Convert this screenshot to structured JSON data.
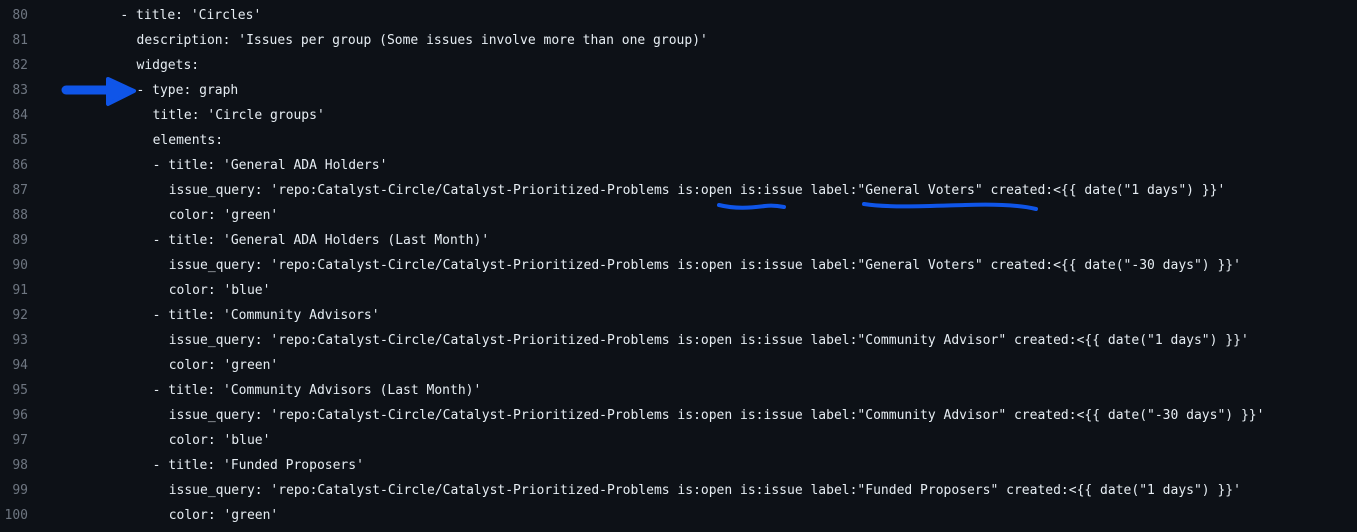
{
  "editor": {
    "accent_color": "#0f55e8",
    "lines": [
      {
        "number": "80",
        "indent": 8,
        "text": "- title: 'Circles'"
      },
      {
        "number": "81",
        "indent": 10,
        "text": "description: 'Issues per group (Some issues involve more than one group)'"
      },
      {
        "number": "82",
        "indent": 10,
        "text": "widgets:"
      },
      {
        "number": "83",
        "indent": 10,
        "text": "- type: graph"
      },
      {
        "number": "84",
        "indent": 12,
        "text": "title: 'Circle groups'"
      },
      {
        "number": "85",
        "indent": 12,
        "text": "elements:"
      },
      {
        "number": "86",
        "indent": 12,
        "text": "- title: 'General ADA Holders'"
      },
      {
        "number": "87",
        "indent": 14,
        "text": "issue_query: 'repo:Catalyst-Circle/Catalyst-Prioritized-Problems is:open is:issue label:\"General Voters\" created:<{{ date(\"1 days\") }}'"
      },
      {
        "number": "88",
        "indent": 14,
        "text": "color: 'green'"
      },
      {
        "number": "89",
        "indent": 12,
        "text": "- title: 'General ADA Holders (Last Month)'"
      },
      {
        "number": "90",
        "indent": 14,
        "text": "issue_query: 'repo:Catalyst-Circle/Catalyst-Prioritized-Problems is:open is:issue label:\"General Voters\" created:<{{ date(\"-30 days\") }}'"
      },
      {
        "number": "91",
        "indent": 14,
        "text": "color: 'blue'"
      },
      {
        "number": "92",
        "indent": 12,
        "text": "- title: 'Community Advisors'"
      },
      {
        "number": "93",
        "indent": 14,
        "text": "issue_query: 'repo:Catalyst-Circle/Catalyst-Prioritized-Problems is:open is:issue label:\"Community Advisor\" created:<{{ date(\"1 days\") }}'"
      },
      {
        "number": "94",
        "indent": 14,
        "text": "color: 'green'"
      },
      {
        "number": "95",
        "indent": 12,
        "text": "- title: 'Community Advisors (Last Month)'"
      },
      {
        "number": "96",
        "indent": 14,
        "text": "issue_query: 'repo:Catalyst-Circle/Catalyst-Prioritized-Problems is:open is:issue label:\"Community Advisor\" created:<{{ date(\"-30 days\") }}'"
      },
      {
        "number": "97",
        "indent": 14,
        "text": "color: 'blue'"
      },
      {
        "number": "98",
        "indent": 12,
        "text": "- title: 'Funded Proposers'"
      },
      {
        "number": "99",
        "indent": 14,
        "text": "issue_query: 'repo:Catalyst-Circle/Catalyst-Prioritized-Problems is:open is:issue label:\"Funded Proposers\" created:<{{ date(\"1 days\") }}'"
      },
      {
        "number": "100",
        "indent": 14,
        "text": "color: 'green'"
      }
    ]
  }
}
